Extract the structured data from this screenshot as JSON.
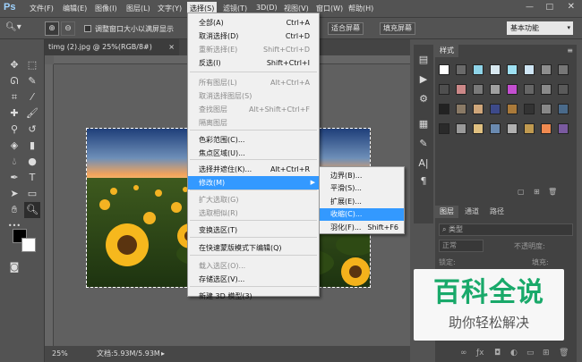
{
  "app": {
    "logo": "Ps"
  },
  "menubar": {
    "items": [
      "文件(F)",
      "编辑(E)",
      "图像(I)",
      "图层(L)",
      "文字(Y)",
      "选择(S)",
      "滤镜(T)",
      "3D(D)",
      "视图(V)",
      "窗口(W)",
      "帮助(H)"
    ],
    "active_index": 5
  },
  "window_controls": {
    "minimize": "—",
    "maximize": "□",
    "close": "✕"
  },
  "options": {
    "resize_windows_label": "调整窗口大小以满屏显示",
    "fit_screen": "适合屏幕",
    "fill_screen": "填充屏幕",
    "workspace": "基本功能"
  },
  "document": {
    "tab_title": "timg (2).jpg @ 25%(RGB/8#)",
    "tab_close": "×",
    "zoom": "25%",
    "doc_size": "文档:5.93M/5.93M"
  },
  "select_menu": {
    "items": [
      {
        "label": "全部(A)",
        "shortcut": "Ctrl+A",
        "disabled": false
      },
      {
        "label": "取消选择(D)",
        "shortcut": "Ctrl+D",
        "disabled": false
      },
      {
        "label": "重新选择(E)",
        "shortcut": "Shift+Ctrl+D",
        "disabled": true
      },
      {
        "label": "反选(I)",
        "shortcut": "Shift+Ctrl+I",
        "disabled": false
      },
      {
        "label": "所有图层(L)",
        "shortcut": "Alt+Ctrl+A",
        "disabled": true
      },
      {
        "label": "取消选择图层(S)",
        "shortcut": "",
        "disabled": true
      },
      {
        "label": "查找图层",
        "shortcut": "Alt+Shift+Ctrl+F",
        "disabled": true
      },
      {
        "label": "隔离图层",
        "shortcut": "",
        "disabled": true
      },
      {
        "label": "色彩范围(C)...",
        "shortcut": "",
        "disabled": false
      },
      {
        "label": "焦点区域(U)...",
        "shortcut": "",
        "disabled": false
      },
      {
        "label": "选择并遮住(K)...",
        "shortcut": "Alt+Ctrl+R",
        "disabled": false
      },
      {
        "label": "修改(M)",
        "shortcut": "",
        "disabled": false,
        "submenu": true,
        "highlighted": true
      },
      {
        "label": "扩大选取(G)",
        "shortcut": "",
        "disabled": true
      },
      {
        "label": "选取相似(R)",
        "shortcut": "",
        "disabled": true
      },
      {
        "label": "变换选区(T)",
        "shortcut": "",
        "disabled": false
      },
      {
        "label": "在快速蒙版模式下编辑(Q)",
        "shortcut": "",
        "disabled": false
      },
      {
        "label": "载入选区(O)...",
        "shortcut": "",
        "disabled": true
      },
      {
        "label": "存储选区(V)...",
        "shortcut": "",
        "disabled": false
      },
      {
        "label": "新建 3D 模型(3)",
        "shortcut": "",
        "disabled": false
      }
    ]
  },
  "modify_submenu": {
    "items": [
      {
        "label": "边界(B)...",
        "shortcut": ""
      },
      {
        "label": "平滑(S)...",
        "shortcut": ""
      },
      {
        "label": "扩展(E)...",
        "shortcut": ""
      },
      {
        "label": "收缩(C)...",
        "shortcut": "",
        "highlighted": true
      },
      {
        "label": "羽化(F)...",
        "shortcut": "Shift+F6"
      }
    ]
  },
  "panels": {
    "styles_tab": "样式",
    "layers_tabs": [
      "图层",
      "通道",
      "路径"
    ],
    "kind_label": "类型",
    "blend_mode": "正常",
    "opacity_label": "不透明度:",
    "lock_label": "锁定:",
    "fill_label": "填充:"
  },
  "watermark": {
    "title": "百科全说",
    "subtitle": "助你轻松解决"
  }
}
